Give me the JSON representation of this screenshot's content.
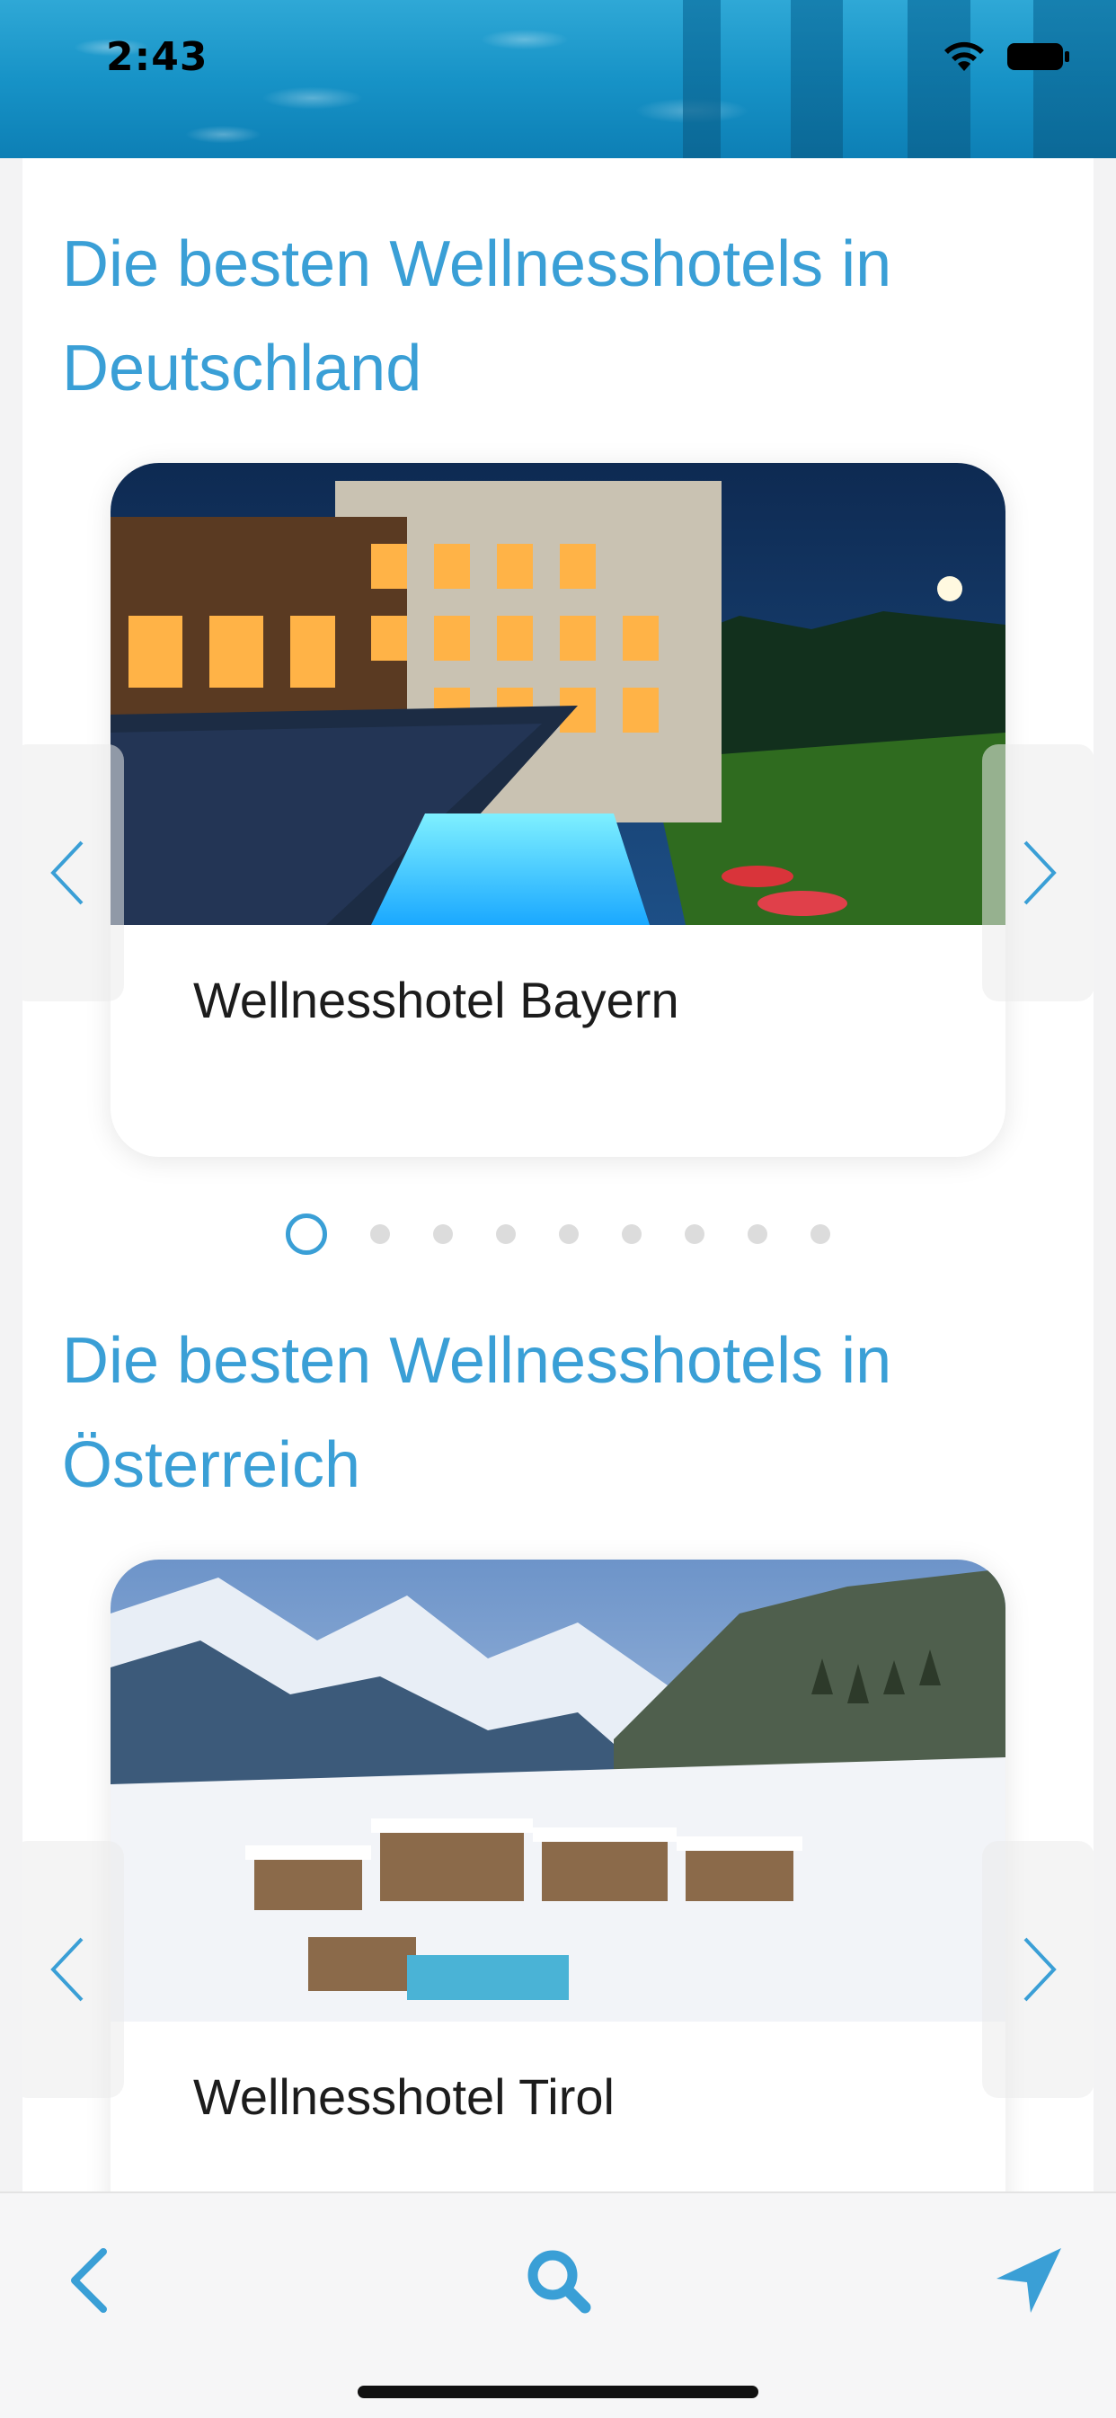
{
  "status_bar": {
    "time": "2:43",
    "icons": [
      "wifi-icon",
      "battery-icon"
    ]
  },
  "sections": [
    {
      "title": "Die besten Wellnesshotels in Deutschland",
      "hotel": {
        "name": "Wellnesshotel Bayern",
        "photo": "hotel-night-pool-photo"
      },
      "pagination": {
        "count": 9,
        "active_index": 0
      }
    },
    {
      "title": "Die besten Wellnesshotels in Österreich",
      "hotel": {
        "name": "Wellnesshotel Tirol",
        "photo": "hotel-snow-mountain-photo"
      }
    }
  ],
  "toolbar": {
    "items": [
      "back-icon",
      "search-icon",
      "location-arrow-icon"
    ]
  },
  "colors": {
    "accent": "#3a9fd6",
    "text": "#1c1c1c",
    "background": "#f3f3f4",
    "dot_inactive": "#dcdcdc"
  }
}
